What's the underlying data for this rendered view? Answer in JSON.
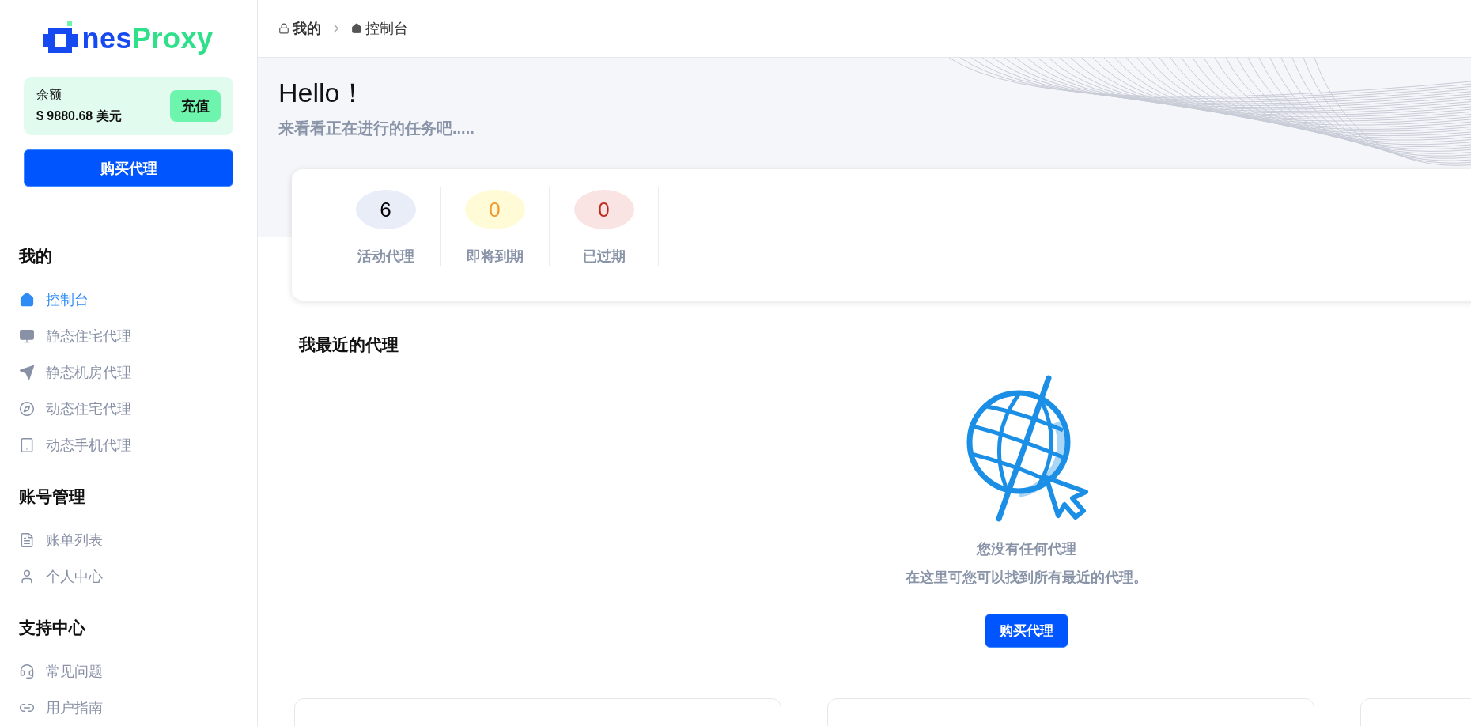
{
  "logo": {
    "text_a": "nes",
    "text_b": "Proxy"
  },
  "balance": {
    "label": "余额",
    "amount": "$ 9880.68 美元",
    "recharge_button": "充值"
  },
  "buy_button": "购买代理",
  "sidebar": [
    {
      "heading": "我的",
      "items": [
        {
          "label": "控制台",
          "selected": true
        },
        {
          "label": "静态住宅代理",
          "selected": false
        },
        {
          "label": "静态机房代理",
          "selected": false
        },
        {
          "label": "动态住宅代理",
          "selected": false
        },
        {
          "label": "动态手机代理",
          "selected": false
        }
      ]
    },
    {
      "heading": "账号管理",
      "items": [
        {
          "label": "账单列表",
          "selected": false
        },
        {
          "label": "个人中心",
          "selected": false
        }
      ]
    },
    {
      "heading": "支持中心",
      "items": [
        {
          "label": "常见问题",
          "selected": false
        },
        {
          "label": "用户指南",
          "selected": false
        }
      ]
    }
  ],
  "breadcrumb": [
    {
      "label": "我的",
      "current": false
    },
    {
      "label": "控制台",
      "current": true
    }
  ],
  "hero": {
    "title": "Hello！",
    "subtitle": "来看看正在进行的任务吧....."
  },
  "stats": [
    {
      "kind": "active",
      "value": "6",
      "label": "活动代理"
    },
    {
      "kind": "expiring",
      "value": "0",
      "label": "即将到期"
    },
    {
      "kind": "expired",
      "value": "0",
      "label": "已过期"
    }
  ],
  "recent": {
    "title": "我最近的代理",
    "empty_title": "您没有任何代理",
    "empty_text": "在这里可您可以找到所有最近的代理。",
    "button": "购买代理"
  }
}
